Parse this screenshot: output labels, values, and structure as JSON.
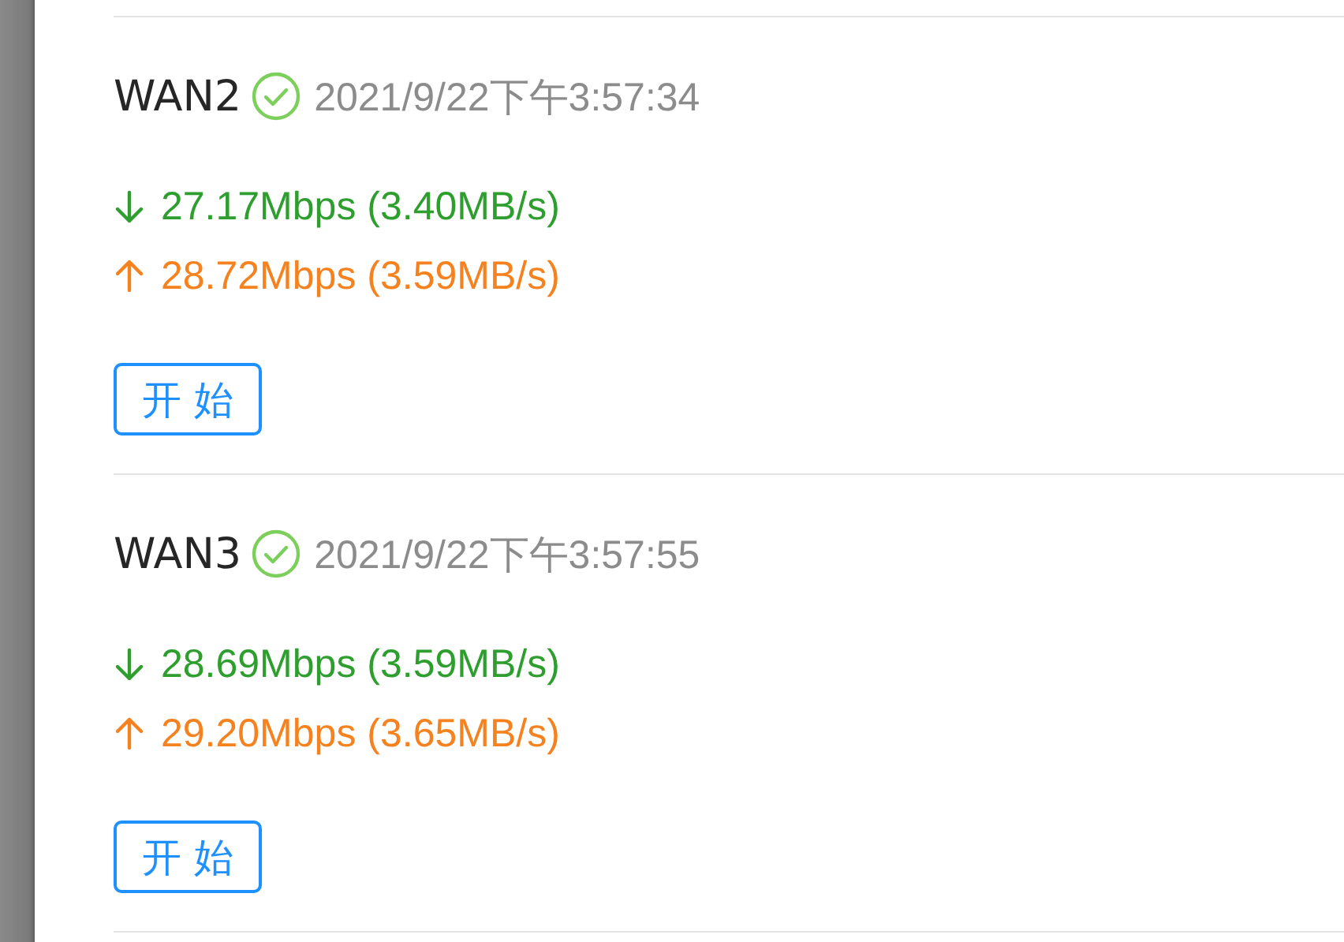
{
  "lines": [
    {
      "name": "WAN2",
      "ok": true,
      "time": "2021/9/22下午3:57:34",
      "download": "27.17Mbps (3.40MB/s)",
      "upload": "28.72Mbps (3.59MB/s)",
      "button": "开 始"
    },
    {
      "name": "WAN3",
      "ok": true,
      "time": "2021/9/22下午3:57:55",
      "download": "28.69Mbps (3.59MB/s)",
      "upload": "29.20Mbps (3.65MB/s)",
      "button": "开 始"
    }
  ]
}
